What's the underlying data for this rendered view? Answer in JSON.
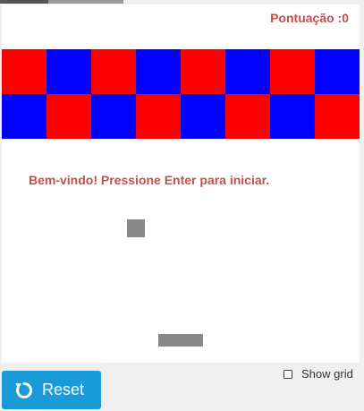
{
  "score": {
    "text": "Pontuação :0"
  },
  "message": {
    "text": "Bem-vindo! Pressione Enter para iniciar."
  },
  "bricks": {
    "rows": [
      [
        "red",
        "blue",
        "red",
        "blue",
        "red",
        "blue",
        "red",
        "blue"
      ],
      [
        "blue",
        "red",
        "blue",
        "red",
        "blue",
        "red",
        "blue",
        "red"
      ]
    ]
  },
  "colors": {
    "red": "#ff0000",
    "blue": "#0000ff",
    "text_accent": "#c0504d",
    "ball": "#888888",
    "paddle": "#888888",
    "reset_button": "#1a9ad6"
  },
  "controls": {
    "reset_label": "Reset",
    "reset_icon": "reset-icon",
    "show_grid_label": "Show grid",
    "show_grid_checked": false
  }
}
